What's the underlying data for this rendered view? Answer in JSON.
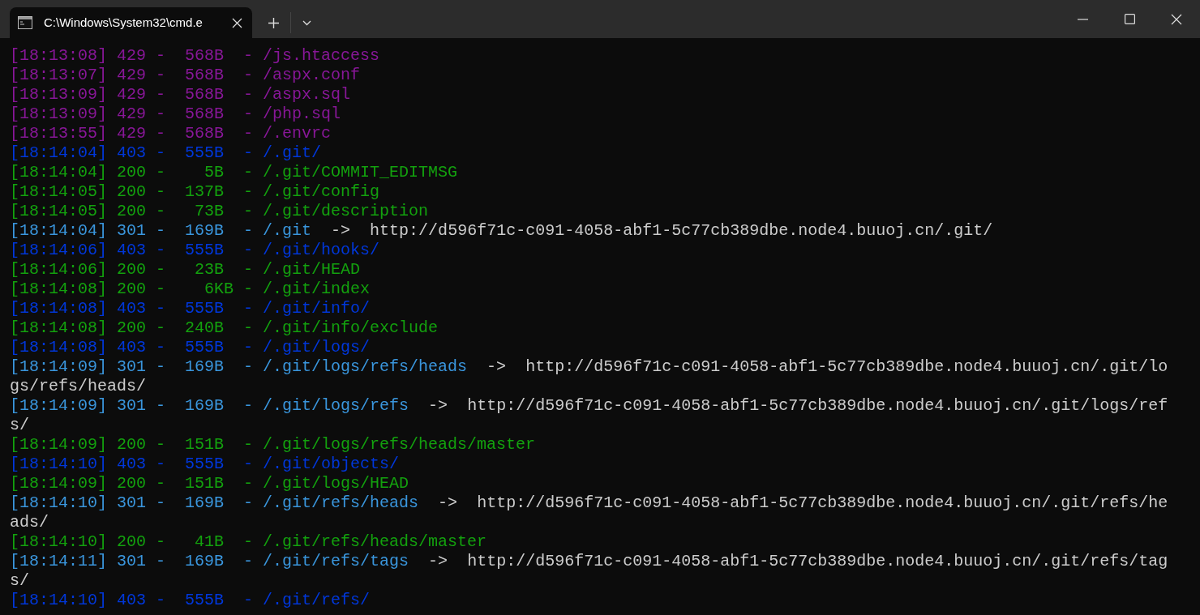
{
  "window": {
    "tab_title": "C:\\Windows\\System32\\cmd.e"
  },
  "terminal": {
    "lines": [
      {
        "text": "[18:13:08] 429 -  568B  - /js.htaccess",
        "color": "#881798"
      },
      {
        "text": "[18:13:07] 429 -  568B  - /aspx.conf",
        "color": "#881798"
      },
      {
        "text": "[18:13:09] 429 -  568B  - /aspx.sql",
        "color": "#881798"
      },
      {
        "text": "[18:13:09] 429 -  568B  - /php.sql",
        "color": "#881798"
      },
      {
        "text": "[18:13:55] 429 -  568B  - /.envrc",
        "color": "#881798"
      },
      {
        "text": "[18:14:04] 403 -  555B  - /.git/",
        "color": "#0037da"
      },
      {
        "text": "[18:14:04] 200 -    5B  - /.git/COMMIT_EDITMSG",
        "color": "#13a10e"
      },
      {
        "text": "[18:14:05] 200 -  137B  - /.git/config",
        "color": "#13a10e"
      },
      {
        "text": "[18:14:05] 200 -   73B  - /.git/description",
        "color": "#13a10e"
      },
      {
        "text": "[18:14:04] 301 -  169B  - /.git",
        "color": "#3a96dd",
        "arrow": "->",
        "url": "http://d596f71c-c091-4058-abf1-5c77cb389dbe.node4.buuoj.cn/.git/"
      },
      {
        "text": "[18:14:06] 403 -  555B  - /.git/hooks/",
        "color": "#0037da"
      },
      {
        "text": "[18:14:06] 200 -   23B  - /.git/HEAD",
        "color": "#13a10e"
      },
      {
        "text": "[18:14:08] 200 -    6KB - /.git/index",
        "color": "#13a10e"
      },
      {
        "text": "[18:14:08] 403 -  555B  - /.git/info/",
        "color": "#0037da"
      },
      {
        "text": "[18:14:08] 200 -  240B  - /.git/info/exclude",
        "color": "#13a10e"
      },
      {
        "text": "[18:14:08] 403 -  555B  - /.git/logs/",
        "color": "#0037da"
      },
      {
        "text": "[18:14:09] 301 -  169B  - /.git/logs/refs/heads",
        "color": "#3a96dd",
        "arrow": "->",
        "url": "http://d596f71c-c091-4058-abf1-5c77cb389dbe.node4.buuoj.cn/.git/logs/refs/heads/"
      },
      {
        "text": "[18:14:09] 301 -  169B  - /.git/logs/refs",
        "color": "#3a96dd",
        "arrow": "->",
        "url": "http://d596f71c-c091-4058-abf1-5c77cb389dbe.node4.buuoj.cn/.git/logs/refs/"
      },
      {
        "text": "[18:14:09] 200 -  151B  - /.git/logs/refs/heads/master",
        "color": "#13a10e"
      },
      {
        "text": "[18:14:10] 403 -  555B  - /.git/objects/",
        "color": "#0037da"
      },
      {
        "text": "[18:14:09] 200 -  151B  - /.git/logs/HEAD",
        "color": "#13a10e"
      },
      {
        "text": "[18:14:10] 301 -  169B  - /.git/refs/heads",
        "color": "#3a96dd",
        "arrow": "->",
        "url": "http://d596f71c-c091-4058-abf1-5c77cb389dbe.node4.buuoj.cn/.git/refs/heads/"
      },
      {
        "text": "[18:14:10] 200 -   41B  - /.git/refs/heads/master",
        "color": "#13a10e"
      },
      {
        "text": "[18:14:11] 301 -  169B  - /.git/refs/tags",
        "color": "#3a96dd",
        "arrow": "->",
        "url": "http://d596f71c-c091-4058-abf1-5c77cb389dbe.node4.buuoj.cn/.git/refs/tags/"
      },
      {
        "text": "[18:14:10] 403 -  555B  - /.git/refs/",
        "color": "#0037da"
      }
    ]
  }
}
